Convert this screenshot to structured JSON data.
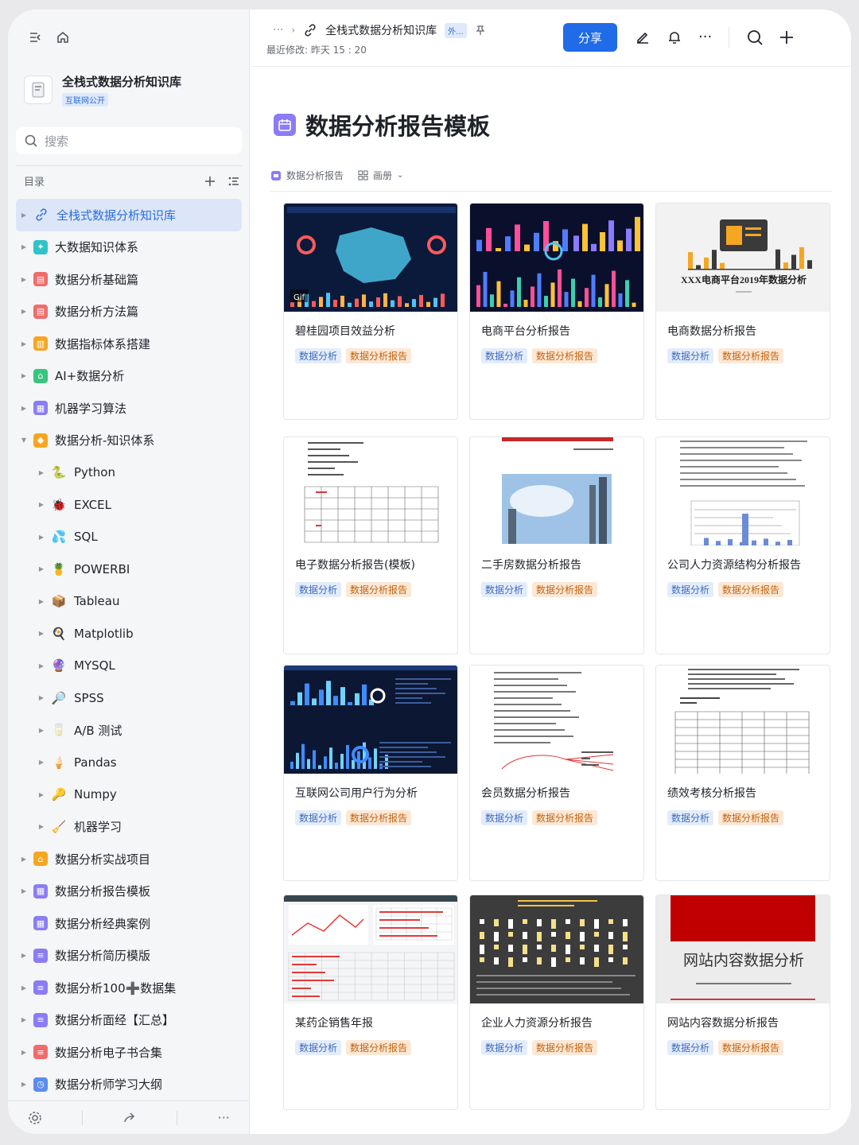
{
  "sidebar": {
    "kb_name": "全栈式数据分析知识库",
    "kb_badge": "互联网公开",
    "search_placeholder": "搜索",
    "toc_title": "目录",
    "items": [
      {
        "label": "全栈式数据分析知识库",
        "icon": "link-icon",
        "active": true,
        "level": 0
      },
      {
        "label": "大数据知识体系",
        "icon": "sparkle-icon",
        "color": "#2fc3c8",
        "level": 0
      },
      {
        "label": "数据分析基础篇",
        "icon": "doc-icon",
        "color": "#f26b6b",
        "level": 0
      },
      {
        "label": "数据分析方法篇",
        "icon": "doc-icon",
        "color": "#f26b6b",
        "level": 0
      },
      {
        "label": "数据指标体系搭建",
        "icon": "chart-icon",
        "color": "#f5a623",
        "level": 0
      },
      {
        "label": "AI+数据分析",
        "icon": "home-icon",
        "color": "#3ac47d",
        "level": 0
      },
      {
        "label": "机器学习算法",
        "icon": "calendar-icon",
        "color": "#8b7cf6",
        "level": 0
      },
      {
        "label": "数据分析-知识体系",
        "icon": "tag-icon",
        "color": "#f5a623",
        "level": 0,
        "expanded": true
      },
      {
        "label": "Python",
        "emoji": "🐍",
        "level": 1
      },
      {
        "label": "EXCEL",
        "emoji": "🐞",
        "level": 1
      },
      {
        "label": "SQL",
        "emoji": "💦",
        "level": 1
      },
      {
        "label": "POWERBI",
        "emoji": "🍍",
        "level": 1
      },
      {
        "label": "Tableau",
        "emoji": "📦",
        "level": 1
      },
      {
        "label": "Matplotlib",
        "emoji": "🍳",
        "level": 1
      },
      {
        "label": "MYSQL",
        "emoji": "🔮",
        "level": 1
      },
      {
        "label": "SPSS",
        "emoji": "🔎",
        "level": 1
      },
      {
        "label": "A/B 测试",
        "emoji": "🥛",
        "level": 1
      },
      {
        "label": "Pandas",
        "emoji": "🍦",
        "level": 1
      },
      {
        "label": "Numpy",
        "emoji": "🔑",
        "level": 1
      },
      {
        "label": "机器学习",
        "emoji": "🧹",
        "level": 1
      },
      {
        "label": "数据分析实战项目",
        "icon": "home-icon",
        "color": "#f5a623",
        "level": 0
      },
      {
        "label": "数据分析报告模板",
        "icon": "calendar-icon",
        "color": "#8b7cf6",
        "level": 0
      },
      {
        "label": "数据分析经典案例",
        "icon": "calendar-icon",
        "color": "#8b7cf6",
        "level": 0,
        "no_caret": true
      },
      {
        "label": "数据分析简历模版",
        "icon": "list-icon",
        "color": "#8b7cf6",
        "level": 0
      },
      {
        "label": "数据分析100➕数据集",
        "icon": "list-icon",
        "color": "#8b7cf6",
        "level": 0
      },
      {
        "label": "数据分析面经【汇总】",
        "icon": "list-icon",
        "color": "#8b7cf6",
        "level": 0
      },
      {
        "label": "数据分析电子书合集",
        "icon": "list-icon",
        "color": "#f26b6b",
        "level": 0
      },
      {
        "label": "数据分析师学习大纲",
        "icon": "clock-icon",
        "color": "#5b8def",
        "level": 0
      }
    ]
  },
  "header": {
    "more": "···",
    "breadcrumb": "全栈式数据分析知识库",
    "ext_tag": "外...",
    "modified": "最近修改: 昨天 15 : 20",
    "share": "分享"
  },
  "main": {
    "title": "数据分析报告模板",
    "view_db": "数据分析报告",
    "view_mode": "画册",
    "cards": [
      {
        "title": "碧桂园项目效益分析",
        "thumb": "dash-map",
        "tags": [
          "数据分析",
          "数据分析报告"
        ]
      },
      {
        "title": "电商平台分析报告",
        "thumb": "dash-dark",
        "tags": [
          "数据分析",
          "数据分析报告"
        ]
      },
      {
        "title": "电商数据分析报告",
        "thumb": "cover-ecom",
        "cover_text": "XXX电商平台2019年数据分析",
        "tags": [
          "数据分析",
          "数据分析报告"
        ]
      },
      {
        "title": "电子数据分析报告(模板)",
        "thumb": "doc-table",
        "tags": [
          "数据分析",
          "数据分析报告"
        ]
      },
      {
        "title": "二手房数据分析报告",
        "thumb": "doc-photo",
        "tags": [
          "数据分析",
          "数据分析报告"
        ]
      },
      {
        "title": "公司人力资源结构分析报告",
        "thumb": "doc-chart",
        "tags": [
          "数据分析",
          "数据分析报告"
        ]
      },
      {
        "title": "互联网公司用户行为分析",
        "thumb": "dash-dark2",
        "tags": [
          "数据分析",
          "数据分析报告"
        ]
      },
      {
        "title": "会员数据分析报告",
        "thumb": "doc-mindmap",
        "tags": [
          "数据分析",
          "数据分析报告"
        ]
      },
      {
        "title": "绩效考核分析报告",
        "thumb": "doc-table2",
        "tags": [
          "数据分析",
          "数据分析报告"
        ]
      },
      {
        "title": "某药企销售年报",
        "thumb": "dash-light",
        "tags": [
          "数据分析",
          "数据分析报告"
        ]
      },
      {
        "title": "企业人力资源分析报告",
        "thumb": "dash-gray",
        "tags": [
          "数据分析",
          "数据分析报告"
        ]
      },
      {
        "title": "网站内容数据分析报告",
        "thumb": "cover-red",
        "cover_text": "网站内容数据分析",
        "tags": [
          "数据分析",
          "数据分析报告"
        ]
      }
    ]
  },
  "colors": {
    "accent": "#1f6be8",
    "active_bg": "#dde6f8",
    "tag_blue": "#e3ecfb",
    "tag_orange": "#fde8d6"
  }
}
